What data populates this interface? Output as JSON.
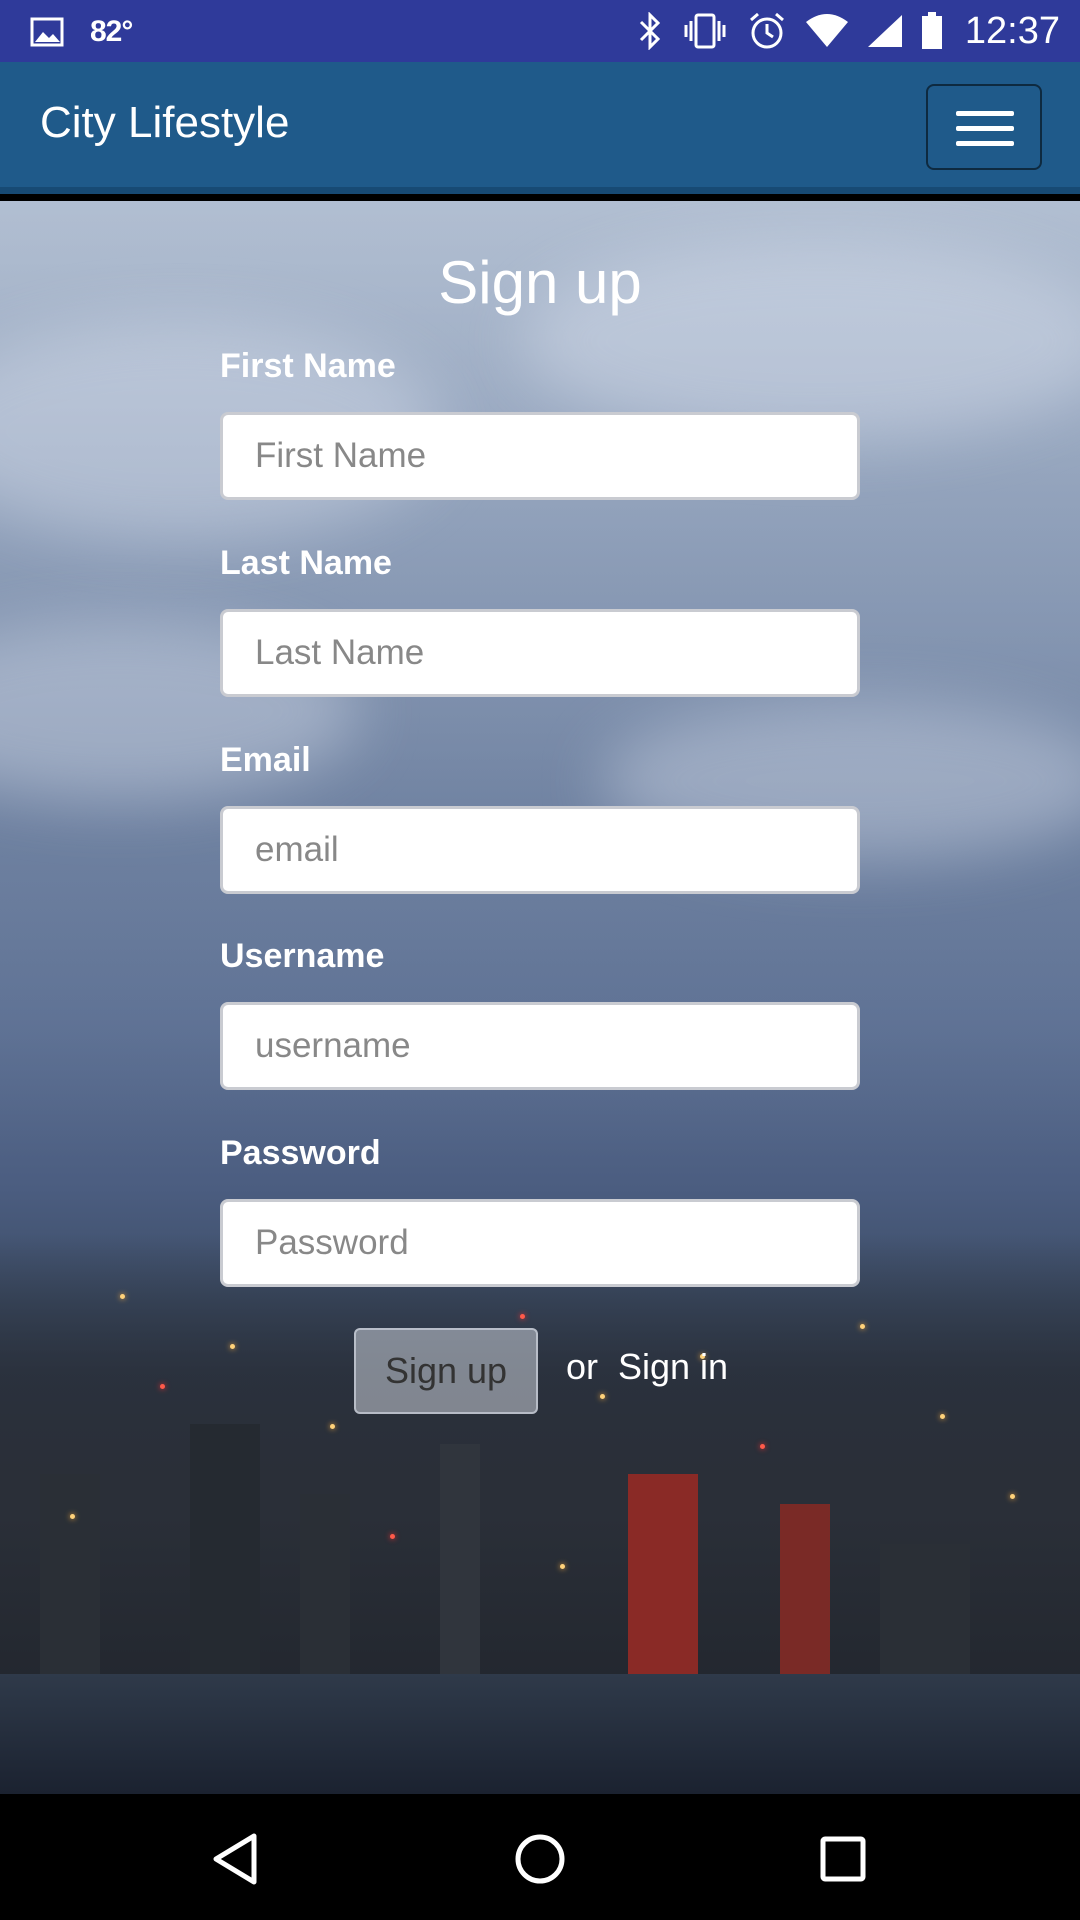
{
  "status_bar": {
    "temperature": "82°",
    "time": "12:37",
    "icons": [
      "image-icon",
      "bluetooth-icon",
      "vibrate-icon",
      "alarm-icon",
      "wifi-icon",
      "signal-icon",
      "battery-icon"
    ]
  },
  "app_bar": {
    "title": "City Lifestyle",
    "menu_icon": "hamburger-menu-icon"
  },
  "form": {
    "title": "Sign up",
    "fields": [
      {
        "label": "First Name",
        "placeholder": "First Name",
        "value": ""
      },
      {
        "label": "Last Name",
        "placeholder": "Last Name",
        "value": ""
      },
      {
        "label": "Email",
        "placeholder": "email",
        "value": ""
      },
      {
        "label": "Username",
        "placeholder": "username",
        "value": ""
      },
      {
        "label": "Password",
        "placeholder": "Password",
        "value": ""
      }
    ],
    "submit_label": "Sign up",
    "or_text": "or",
    "signin_label": "Sign in"
  },
  "nav_bar": {
    "icons": [
      "back-icon",
      "home-icon",
      "recents-icon"
    ]
  },
  "colors": {
    "status_bar": "#2f3a9a",
    "app_bar": "#1f5a8a",
    "nav_bar": "#000000"
  }
}
